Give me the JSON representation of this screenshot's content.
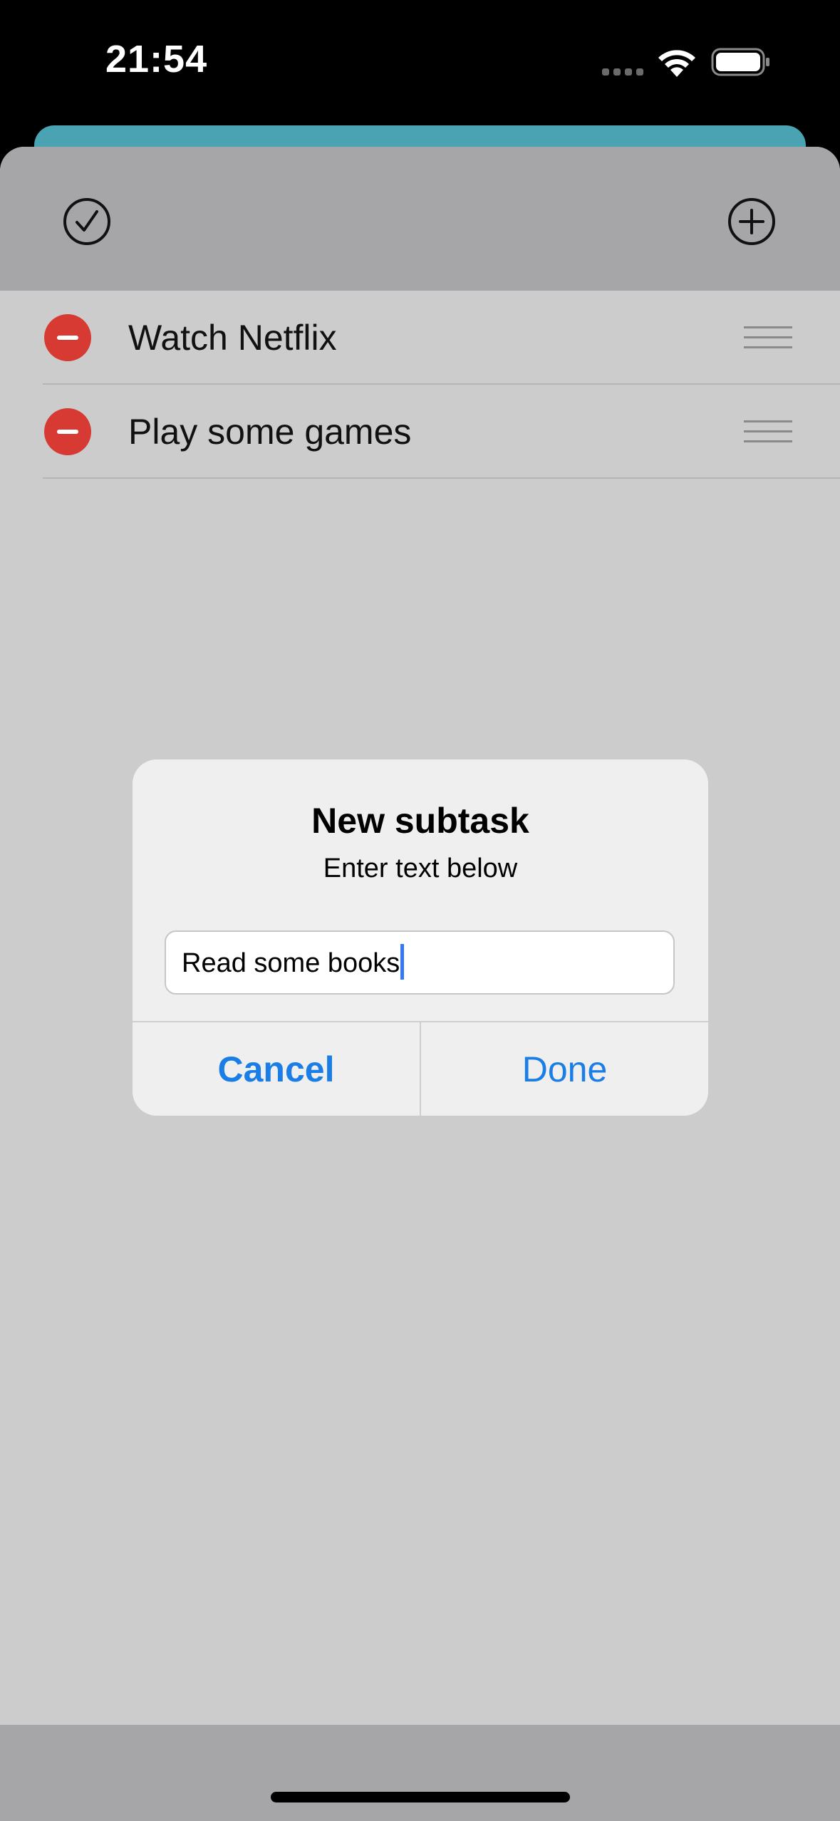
{
  "status_bar": {
    "time": "21:54"
  },
  "toolbar": {
    "left_icon": "checkmark-circle-icon",
    "right_icon": "plus-circle-icon"
  },
  "subtasks": [
    {
      "label": "Watch Netflix"
    },
    {
      "label": "Play some games"
    }
  ],
  "alert": {
    "title": "New subtask",
    "message": "Enter text below",
    "input_value": "Read some books",
    "cancel_label": "Cancel",
    "done_label": "Done"
  },
  "colors": {
    "accent_blue": "#1a7ee6",
    "delete_red": "#d63a33",
    "back_card_teal": "#4aa3b2"
  }
}
